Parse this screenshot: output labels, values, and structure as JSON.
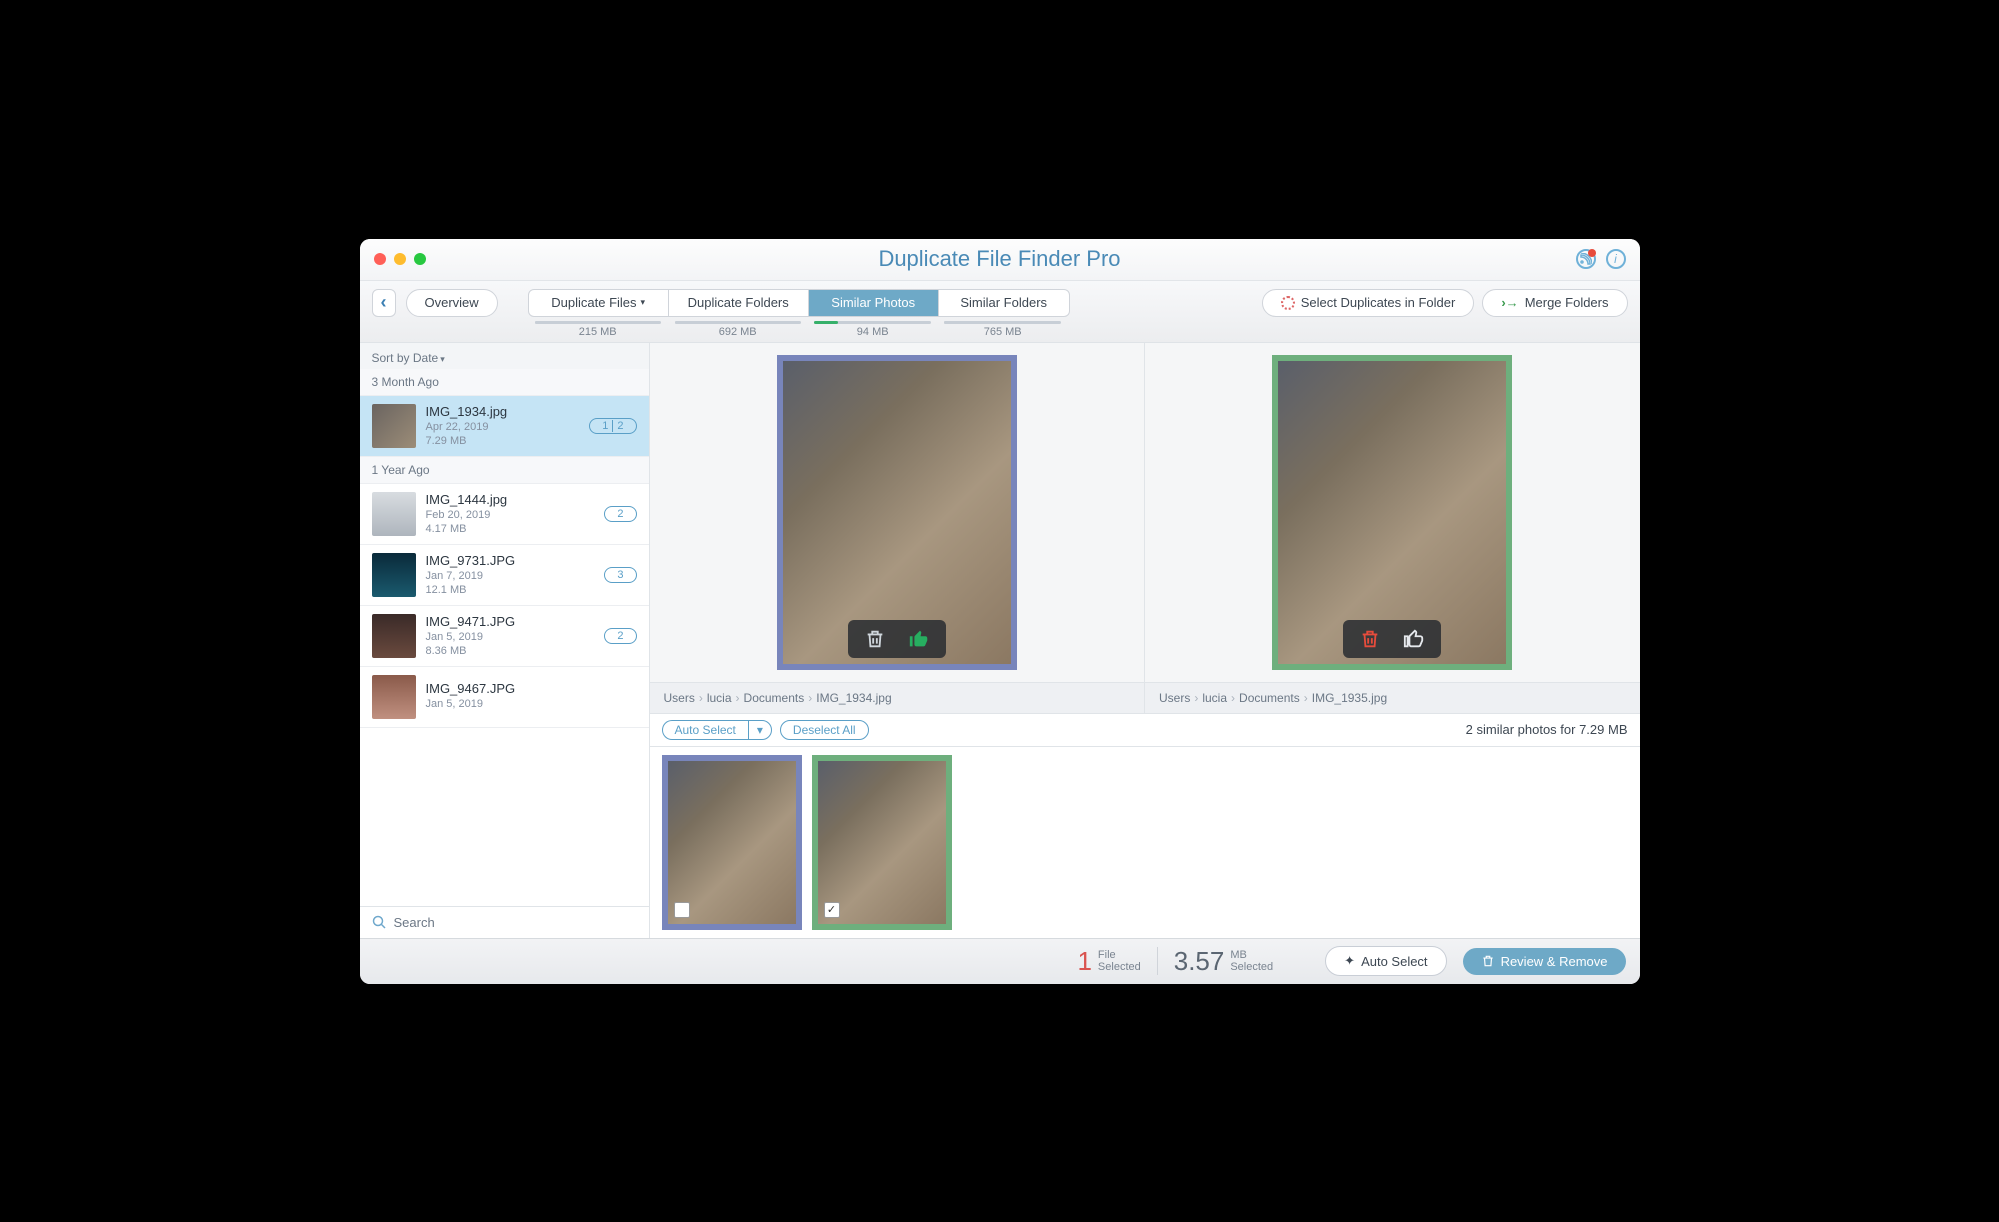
{
  "window": {
    "title": "Duplicate File Finder Pro"
  },
  "toolbar": {
    "back": "‹",
    "overview": "Overview",
    "tabs": [
      {
        "label": "Duplicate Files",
        "size": "215 MB",
        "dropdown": true
      },
      {
        "label": "Duplicate Folders",
        "size": "692 MB"
      },
      {
        "label": "Similar Photos",
        "size": "94 MB",
        "active": true
      },
      {
        "label": "Similar Folders",
        "size": "765 MB"
      }
    ],
    "select_duplicates": "Select Duplicates in Folder",
    "merge_folders": "Merge Folders"
  },
  "sidebar": {
    "sort_label": "Sort by Date",
    "groups": [
      {
        "label": "3 Month Ago",
        "items": [
          {
            "name": "IMG_1934.jpg",
            "date": "Apr 22, 2019",
            "size": "7.29 MB",
            "badge": [
              "1",
              "2"
            ],
            "selected": true
          }
        ]
      },
      {
        "label": "1 Year Ago",
        "items": [
          {
            "name": "IMG_1444.jpg",
            "date": "Feb 20, 2019",
            "size": "4.17 MB",
            "badge": [
              "2"
            ]
          },
          {
            "name": "IMG_9731.JPG",
            "date": "Jan 7, 2019",
            "size": "12.1 MB",
            "badge": [
              "3"
            ]
          },
          {
            "name": "IMG_9471.JPG",
            "date": "Jan 5, 2019",
            "size": "8.36 MB",
            "badge": [
              "2"
            ]
          },
          {
            "name": "IMG_9467.JPG",
            "date": "Jan 5, 2019",
            "size": "",
            "badge": []
          }
        ]
      }
    ],
    "search_placeholder": "Search"
  },
  "preview": {
    "left": {
      "path": [
        "Users",
        "lucia",
        "Documents",
        "IMG_1934.jpg"
      ],
      "border": "blue",
      "trash": "gray",
      "thumb": "green"
    },
    "right": {
      "path": [
        "Users",
        "lucia",
        "Documents",
        "IMG_1935.jpg"
      ],
      "border": "green",
      "trash": "red",
      "thumb": "white"
    }
  },
  "stripbar": {
    "auto_select": "Auto Select",
    "deselect_all": "Deselect All",
    "info": "2 similar photos for 7.29 MB"
  },
  "strip": [
    {
      "border": "blue",
      "checked": false
    },
    {
      "border": "green",
      "checked": true
    }
  ],
  "footer": {
    "files_num": "1",
    "files_label_top": "File",
    "files_label_bot": "Selected",
    "mb_num": "3.57",
    "mb_label_top": "MB",
    "mb_label_bot": "Selected",
    "auto_select": "Auto Select",
    "review": "Review & Remove"
  }
}
